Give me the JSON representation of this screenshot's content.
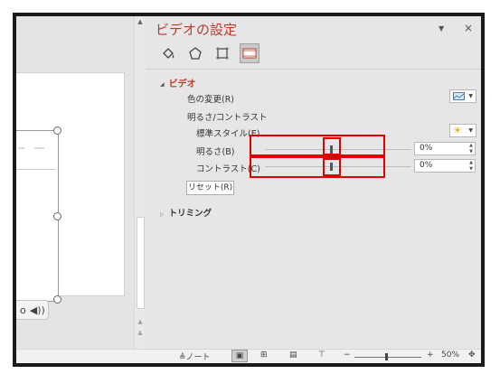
{
  "pane": {
    "title": "ビデオの設定",
    "dropdown_icon": "triangle-down-icon",
    "close_glyph": "×",
    "tabs": [
      {
        "icon": "fill-bucket-icon"
      },
      {
        "icon": "pentagon-shape-icon"
      },
      {
        "icon": "size-properties-icon"
      },
      {
        "icon": "video-film-icon",
        "active": true
      }
    ],
    "section_video": "ビデオ",
    "color_change_label": "色の変更(R)",
    "brightness_contrast_label": "明るさ/コントラスト",
    "preset_style_label": "標準スタイル(E)",
    "brightness_label": "明るさ(B)",
    "brightness_value": "0%",
    "contrast_label": "コントラスト(C)",
    "contrast_value": "0%",
    "reset_label": "リセット(R)",
    "section_trimming": "トリミング"
  },
  "slide": {
    "playbar_icons": [
      "play-icon",
      "volume-icon"
    ],
    "playbar_glyphs": [
      "o",
      "◀))"
    ]
  },
  "status_bar": {
    "notes_label": "≜ノート",
    "zoom_minus": "−",
    "zoom_plus": "+",
    "zoom_level": "50%"
  },
  "colors": {
    "accent_title": "#c0392b",
    "highlight": "#e00000"
  }
}
